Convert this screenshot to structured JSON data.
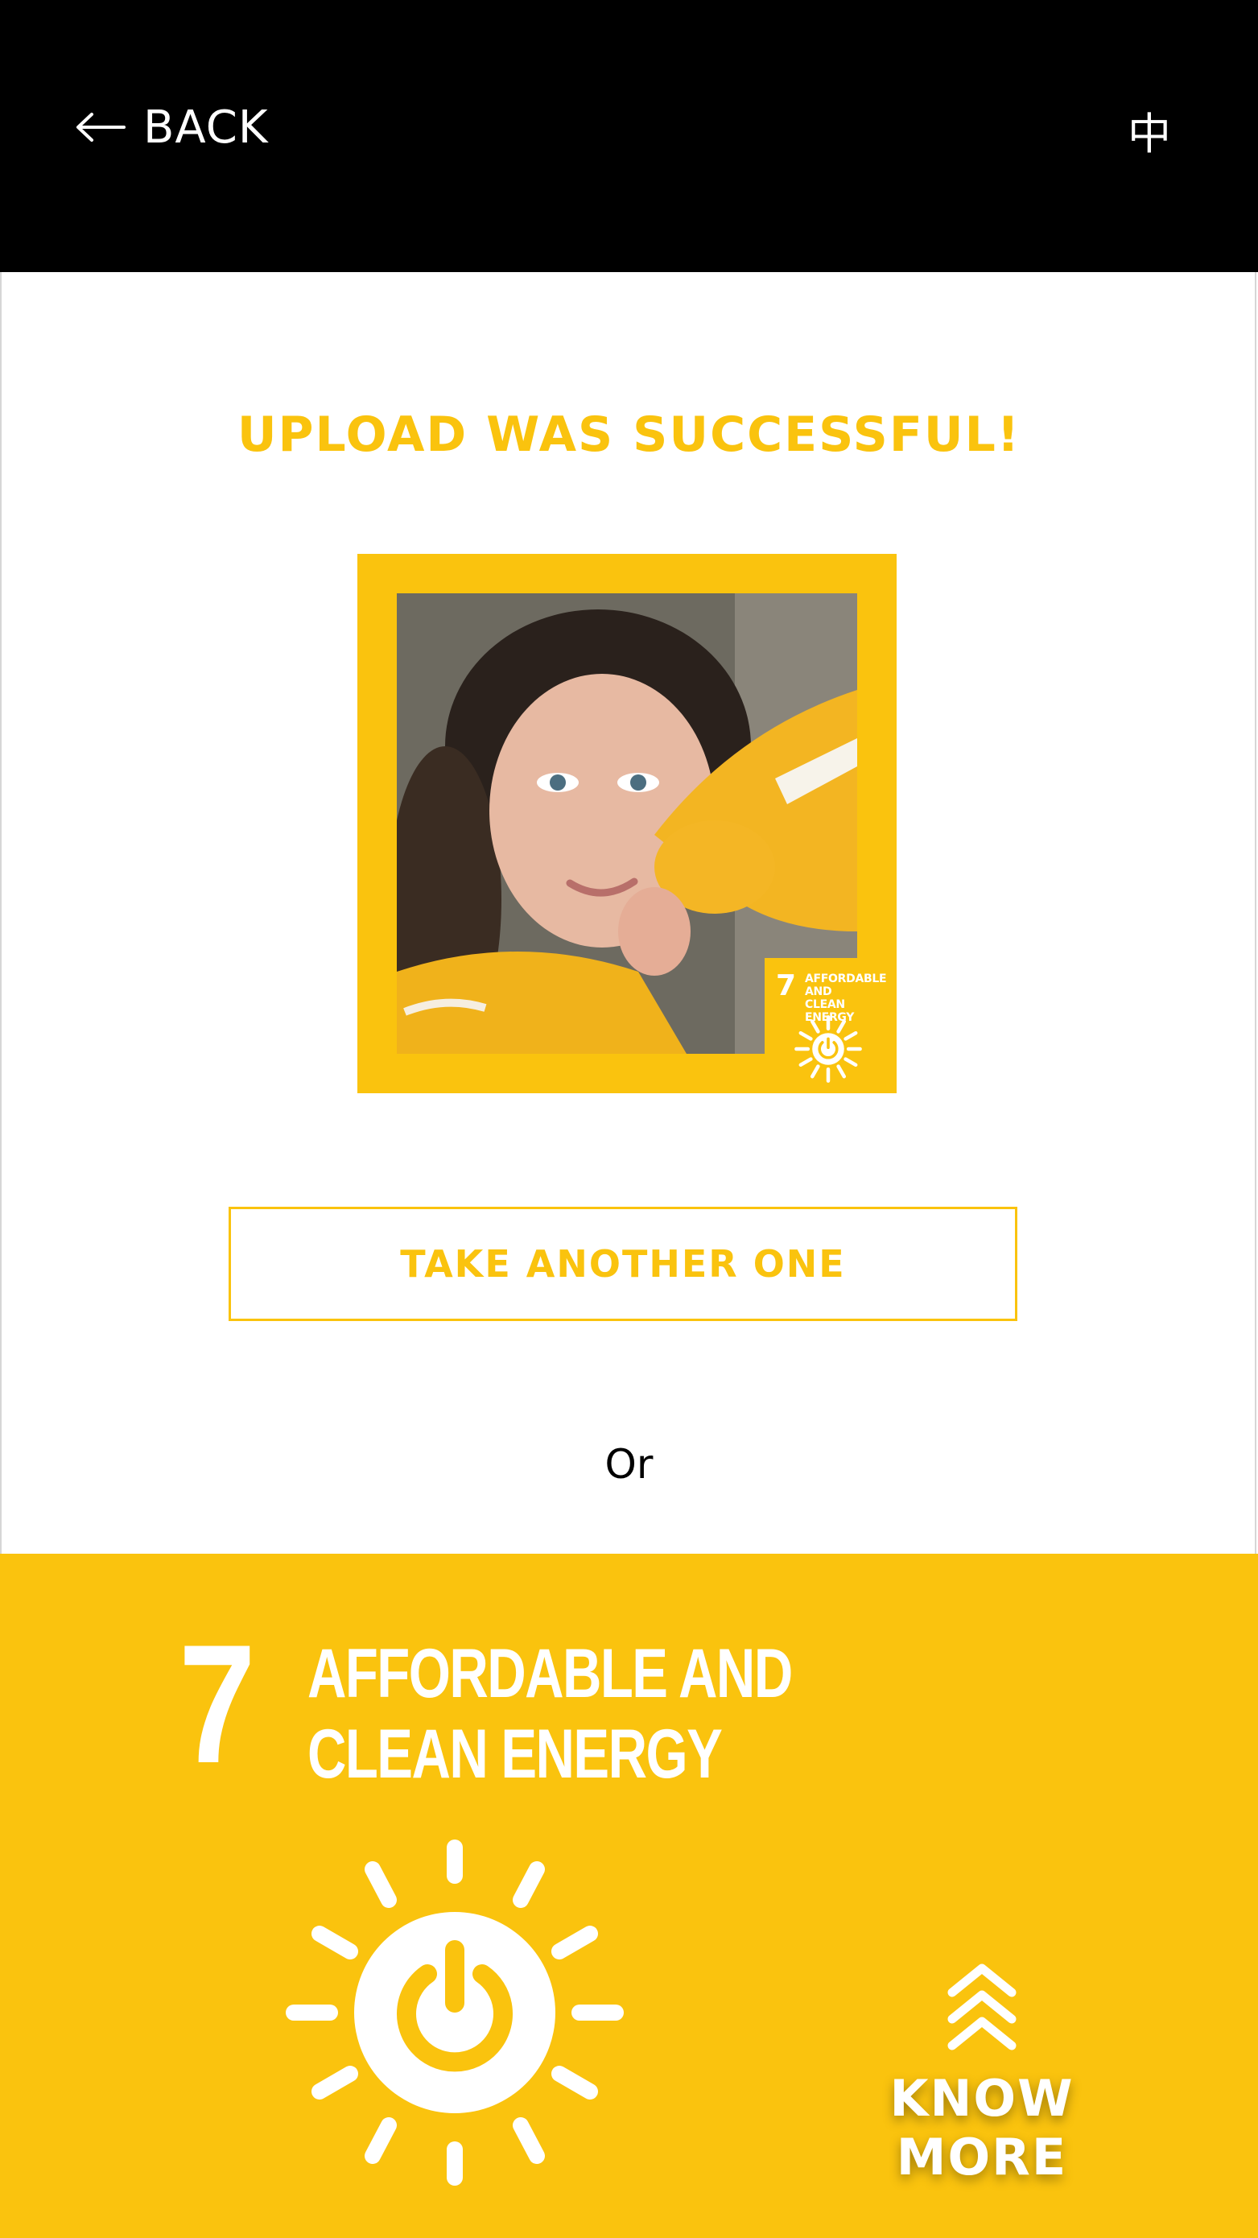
{
  "header": {
    "back_label": "BACK",
    "language_toggle": "中"
  },
  "main": {
    "title": "UPLOAD WAS SUCCESSFUL!",
    "photo_badge": {
      "number": "7",
      "line1": "AFFORDABLE AND",
      "line2": "CLEAN ENERGY"
    },
    "take_another_label": "TAKE ANOTHER ONE",
    "or_label": "Or"
  },
  "sdg": {
    "number": "7",
    "title_line1": "AFFORDABLE AND",
    "title_line2": "CLEAN ENERGY",
    "know_more_label": "KNOW MORE"
  },
  "colors": {
    "accent": "#fac30e",
    "header_bg": "#000000",
    "background": "#ffffff"
  },
  "icons": [
    "arrow-left-icon",
    "sun-power-icon",
    "chevron-double-up-icon"
  ]
}
